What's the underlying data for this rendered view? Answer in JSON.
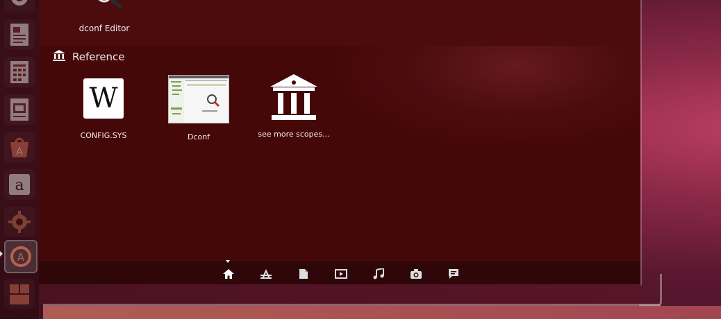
{
  "launcher": {
    "items": [
      {
        "icon": "ubuntu-logo-icon"
      },
      {
        "icon": "writer-icon"
      },
      {
        "icon": "calc-icon"
      },
      {
        "icon": "impress-icon"
      },
      {
        "icon": "software-center-icon"
      },
      {
        "icon": "amazon-icon"
      },
      {
        "icon": "system-settings-icon"
      },
      {
        "icon": "update-manager-icon"
      },
      {
        "icon": "workspace-switcher-icon"
      }
    ]
  },
  "dash": {
    "previous_item": {
      "label": "dconf Editor",
      "icon": "magnifier-icon"
    },
    "category": {
      "title": "Reference",
      "icon": "reference-building-icon"
    },
    "results": [
      {
        "label": "CONFIG.SYS",
        "icon": "wikipedia-icon",
        "glyph": "W"
      },
      {
        "label": "Dconf",
        "icon": "dconf-thumbnail"
      },
      {
        "label": "see more scopes...",
        "icon": "scopes-building-icon"
      }
    ],
    "lens_bar": {
      "active": "home",
      "lenses": [
        "home-lens-icon",
        "applications-lens-icon",
        "files-lens-icon",
        "video-lens-icon",
        "music-lens-icon",
        "photos-lens-icon",
        "social-lens-icon"
      ]
    }
  },
  "colors": {
    "dash_bg": "#450809",
    "lens_bar_bg": "#2f0708",
    "accent_strip": "#c46a5c"
  }
}
